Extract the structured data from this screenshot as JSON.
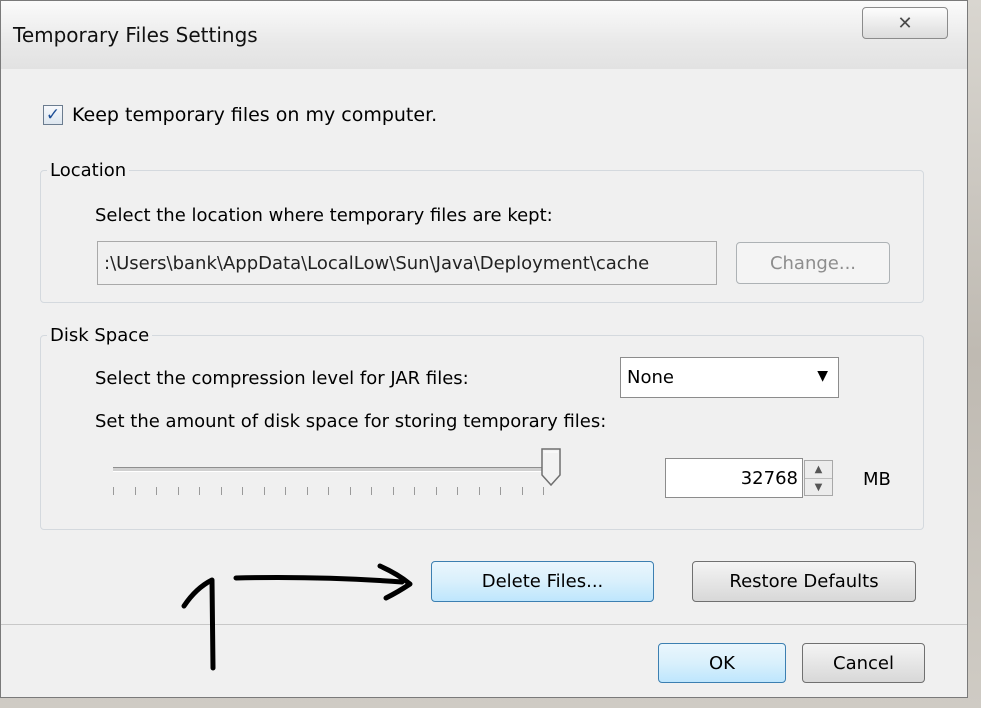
{
  "window": {
    "title": "Temporary Files Settings",
    "close_symbol": "✕"
  },
  "keep_files": {
    "checked": true,
    "label": "Keep temporary files on my computer."
  },
  "location": {
    "legend": "Location",
    "description": "Select the location where temporary files are kept:",
    "path": ":\\Users\\bank\\AppData\\LocalLow\\Sun\\Java\\Deployment\\cache",
    "change_label": "Change..."
  },
  "disk_space": {
    "legend": "Disk Space",
    "compression_label": "Select the compression level for JAR files:",
    "compression_value": "None",
    "amount_label": "Set the amount of disk space for storing temporary files:",
    "slider_level": 1.0,
    "amount_value": "32768",
    "unit": "MB"
  },
  "actions": {
    "delete_label": "Delete Files...",
    "restore_label": "Restore Defaults"
  },
  "footer": {
    "ok_label": "OK",
    "cancel_label": "Cancel"
  },
  "icons": {
    "close": "close-icon",
    "check": "checkmark-icon",
    "dropdown": "chevron-down-icon",
    "spin_up": "spin-up-icon",
    "spin_down": "spin-down-icon"
  }
}
